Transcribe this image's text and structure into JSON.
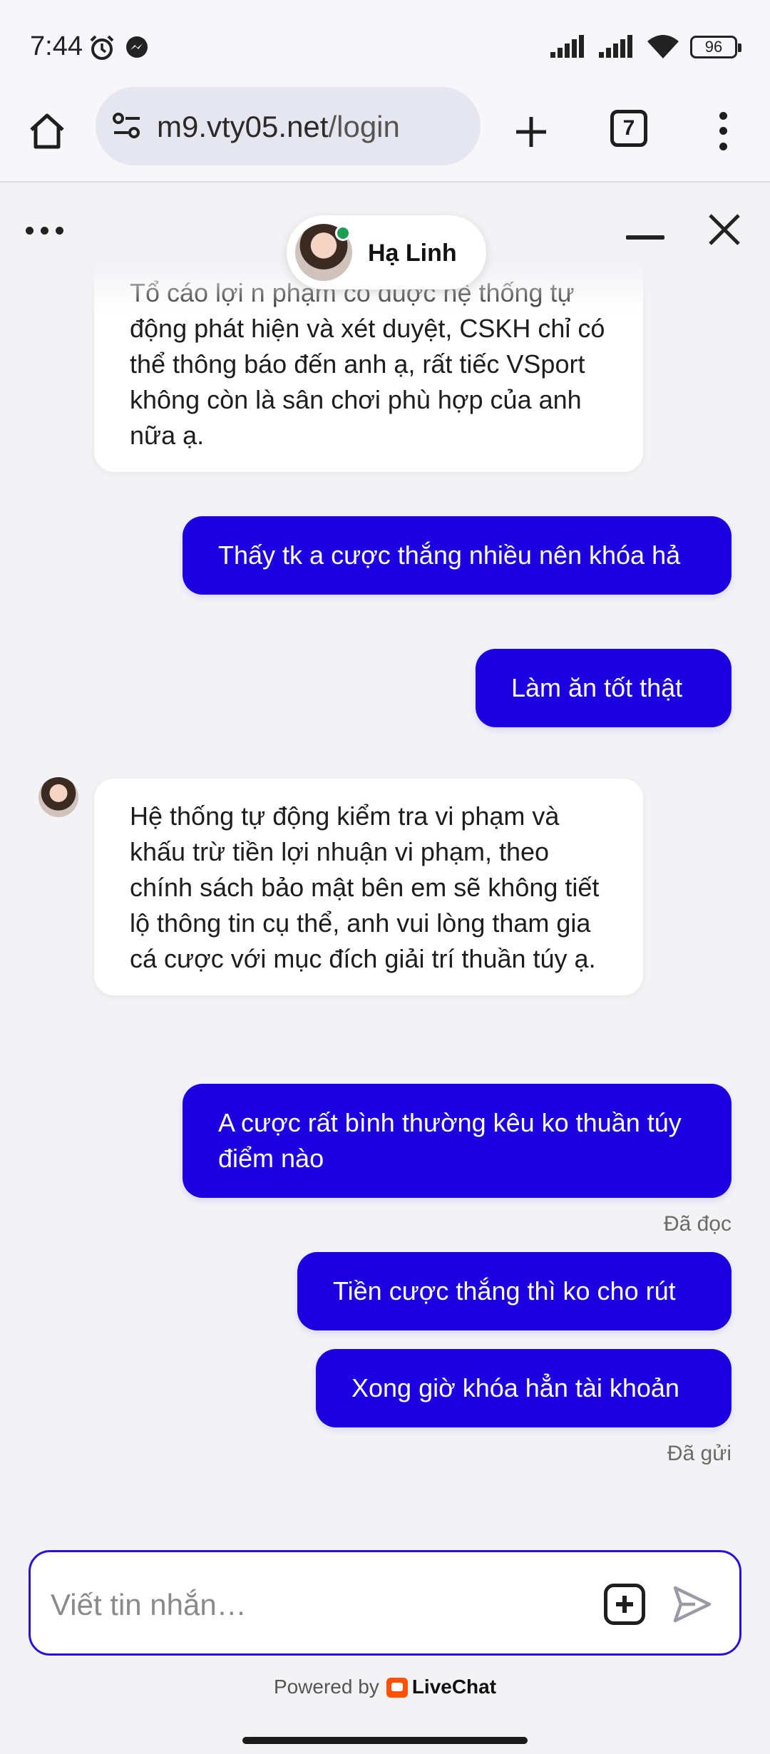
{
  "status_bar": {
    "time": "7:44",
    "battery": "96"
  },
  "browser": {
    "url_host": "m9.vty05.net",
    "url_path": "/login",
    "tab_count": "7"
  },
  "chat": {
    "agent_name": "Hạ Linh",
    "messages": [
      {
        "from": "agent",
        "text": "Tổ cáo lợi n phạm cò duợc hệ thống tự động phát hiện và xét duyệt, CSKH chỉ có thể thông báo đến anh ạ, rất tiếc VSport không còn là sân chơi phù hợp của anh nữa ạ."
      },
      {
        "from": "user",
        "text": "Thấy tk a cược thắng nhiều nên khóa hả"
      },
      {
        "from": "user",
        "text": "Làm ăn tốt thật"
      },
      {
        "from": "agent",
        "text": "Hệ thống tự động kiểm tra vi phạm và khấu trừ tiền lợi nhuận vi phạm, theo chính sách bảo mật bên em sẽ không tiết lộ thông tin cụ thể, anh vui lòng tham gia cá cược với mục đích giải trí thuần túy ạ."
      },
      {
        "from": "user",
        "text": "A cược rất bình thường kêu ko thuần túy điểm nào"
      },
      {
        "from": "user",
        "text": "Tiền cược thắng thì ko cho rút"
      },
      {
        "from": "user",
        "text": "Xong giờ khóa hẳn tài khoản"
      }
    ],
    "status_read": "Đã đọc",
    "status_sent": "Đã gửi",
    "composer_placeholder": "Viết tin nhắn…",
    "powered_by": "Powered by",
    "brand": "LiveChat"
  },
  "colors": {
    "user_bubble": "#1d00e0",
    "agent_bubble": "#ffffff",
    "online": "#1f9d55",
    "brand": "#ff5100"
  },
  "icons": [
    "alarm-icon",
    "messenger-icon",
    "signal-icon",
    "wifi-icon",
    "battery-icon",
    "home-icon",
    "site-settings-icon",
    "plus-icon",
    "tabs-icon",
    "more-vert-icon",
    "more-horiz-icon",
    "minimize-icon",
    "close-icon",
    "attach-icon",
    "send-icon"
  ]
}
